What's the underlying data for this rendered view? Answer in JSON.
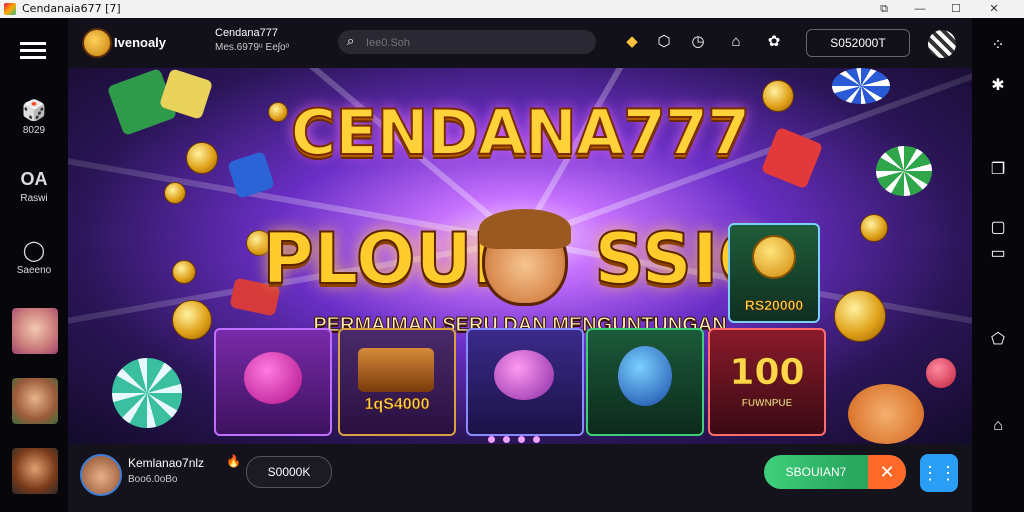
{
  "window": {
    "title": "Cendanaia677 [7]",
    "min": "—",
    "max": "☐",
    "close": "✕",
    "extra": "⧉"
  },
  "left_rail": {
    "items": [
      {
        "label": "8029",
        "glyph": "🎲"
      },
      {
        "label": "Raswi",
        "glyph": "OA"
      },
      {
        "label": "Saeeno",
        "glyph": "◯"
      }
    ]
  },
  "topbar": {
    "brand": "Ivenoaly",
    "sub_title": "Cendana777",
    "sub_line": "Mes.6979ᵘ   Eeʃoᵒ",
    "search_placeholder": "Iee0.Soh",
    "coins": "S052000T",
    "icons": [
      "shield-icon",
      "diamond-icon",
      "clock-icon",
      "gift-icon",
      "settings-icon"
    ]
  },
  "banner": {
    "title_line1": "CENDANA777",
    "title_line2_left": "PLOUI",
    "title_line2_right": "SSIO",
    "tagline": "PERMAIMAN SERU DAN MENGUNTUNGAN",
    "side_card_amount": "RS20000",
    "cards": [
      {
        "label": ""
      },
      {
        "label": "1qS4000"
      },
      {
        "label": ""
      },
      {
        "label": ""
      },
      {
        "label": "100"
      }
    ],
    "card_sub_last": "FUWNPUE"
  },
  "bottom": {
    "user_name": "Kemlanao7nlz",
    "user_sub": "Boo6.0oBo",
    "balance": "S0000K",
    "claim_label": "SBOUIAN7",
    "close_label": "✕",
    "chat_label": "⋮⋮"
  },
  "colors": {
    "accent_gold": "#ffd23a",
    "claim_green": "#3fd07a",
    "close_orange": "#ff6a2a",
    "chat_blue": "#2a9df4"
  }
}
